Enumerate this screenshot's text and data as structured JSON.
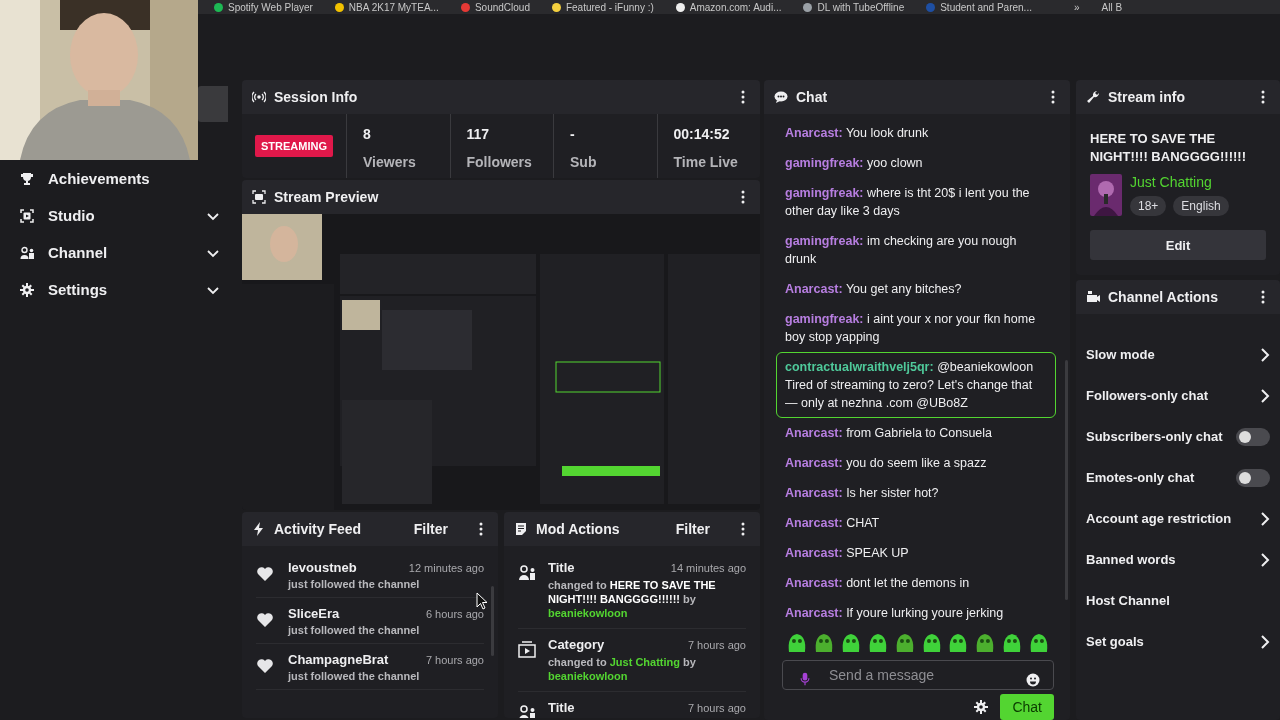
{
  "bookmarks": [
    {
      "label": "Spotify Web Player",
      "color": "#1db954"
    },
    {
      "label": "NBA 2K17 MyTEA...",
      "color": "#f2c200"
    },
    {
      "label": "SoundCloud",
      "color": "#e53935"
    },
    {
      "label": "Featured - iFunny :)",
      "color": "#f4d03f"
    },
    {
      "label": "Amazon.com: Audi...",
      "color": "#eeeeee"
    },
    {
      "label": "DL with TubeOffline",
      "color": "#9aa0a6"
    },
    {
      "label": "Student and Paren...",
      "color": "#1e4fa3"
    }
  ],
  "bookmarks_more": "»",
  "bookmarks_all": "All B",
  "sidebar": {
    "items": [
      {
        "label": "Achievements",
        "expandable": false
      },
      {
        "label": "Studio",
        "expandable": true
      },
      {
        "label": "Channel",
        "expandable": true
      },
      {
        "label": "Settings",
        "expandable": true
      }
    ]
  },
  "session_info": {
    "title": "Session Info",
    "status": "STREAMING",
    "stats": [
      {
        "value": "8",
        "label": "Viewers"
      },
      {
        "value": "117",
        "label": "Followers"
      },
      {
        "value": "-",
        "label": "Sub"
      },
      {
        "value": "00:14:52",
        "label": "Time Live"
      }
    ]
  },
  "stream_preview": {
    "title": "Stream Preview",
    "kind": "picture"
  },
  "activity_feed": {
    "title": "Activity Feed",
    "filter": "Filter",
    "items": [
      {
        "user": "levoustneb",
        "time": "12 minutes ago",
        "text": "just followed the channel"
      },
      {
        "user": "SliceEra",
        "time": "6 hours ago",
        "text": "just followed the channel"
      },
      {
        "user": "ChampagneBrat",
        "time": "7 hours ago",
        "text": "just followed the channel"
      }
    ]
  },
  "mod_actions": {
    "title": "Mod Actions",
    "filter": "Filter",
    "items": [
      {
        "kind": "title",
        "title": "Title",
        "time": "14 minutes ago",
        "prefix": "changed to",
        "value": "HERE TO SAVE THE NIGHT!!!! BANGGGG!!!!!!",
        "suffix": "by",
        "actor": "beaniekowloon"
      },
      {
        "kind": "category",
        "title": "Category",
        "time": "7 hours ago",
        "prefix": "changed to",
        "value": "Just Chatting",
        "suffix": "by",
        "actor": "beaniekowloon"
      },
      {
        "kind": "title",
        "title": "Title",
        "time": "7 hours ago"
      }
    ]
  },
  "chat": {
    "title": "Chat",
    "messages": [
      {
        "user": "Anarcast:",
        "color": "#b77ee0",
        "text": "You look drunk",
        "highlighted": false
      },
      {
        "user": "gamingfreak:",
        "color": "#b77ee0",
        "text": "yoo clown",
        "highlighted": false
      },
      {
        "user": "gamingfreak:",
        "color": "#b77ee0",
        "text": "where is tht 20$ i lent you the other day like 3 days",
        "highlighted": false
      },
      {
        "user": "gamingfreak:",
        "color": "#b77ee0",
        "text": "im checking are you nough drunk",
        "highlighted": false
      },
      {
        "user": "Anarcast:",
        "color": "#b77ee0",
        "text": "You get any bitches?",
        "highlighted": false
      },
      {
        "user": "gamingfreak:",
        "color": "#b77ee0",
        "text": "i aint your x nor your fkn home boy stop yapping",
        "highlighted": false
      },
      {
        "user": "contractualwraithvelj5qr:",
        "color": "#4fc99a",
        "text": "@beaniekowloon Tired of streaming to zero? Let's change that — only at nezhna .com @UBo8Z",
        "highlighted": true
      },
      {
        "user": "Anarcast:",
        "color": "#b77ee0",
        "text": "from Gabriela to Consuela",
        "highlighted": false
      },
      {
        "user": "Anarcast:",
        "color": "#b77ee0",
        "text": "you do seem like a spazz",
        "highlighted": false
      },
      {
        "user": "Anarcast:",
        "color": "#b77ee0",
        "text": "Is her sister hot?",
        "highlighted": false
      },
      {
        "user": "Anarcast:",
        "color": "#b77ee0",
        "text": "CHAT",
        "highlighted": false
      },
      {
        "user": "Anarcast:",
        "color": "#b77ee0",
        "text": "SPEAK UP",
        "highlighted": false
      },
      {
        "user": "Anarcast:",
        "color": "#b77ee0",
        "text": "dont let the demons in",
        "highlighted": false
      },
      {
        "user": "Anarcast:",
        "color": "#b77ee0",
        "text": "If youre lurking youre jerking",
        "highlighted": false
      }
    ],
    "placeholder": "Send a message",
    "send": "Chat"
  },
  "stream_info": {
    "title": "Stream info",
    "stream_title": "HERE TO SAVE THE NIGHT!!!! BANGGGG!!!!!!",
    "category": "Just Chatting",
    "tags": [
      "18+",
      "English"
    ],
    "edit": "Edit"
  },
  "channel_actions": {
    "title": "Channel Actions",
    "items": [
      {
        "kind": "submenu",
        "label": "Slow mode"
      },
      {
        "kind": "submenu",
        "label": "Followers-only chat"
      },
      {
        "kind": "toggle",
        "label": "Subscribers-only chat",
        "on": false
      },
      {
        "kind": "toggle",
        "label": "Emotes-only chat",
        "on": false
      },
      {
        "kind": "submenu",
        "label": "Account age restriction"
      },
      {
        "kind": "submenu",
        "label": "Banned words"
      },
      {
        "kind": "plain",
        "label": "Host Channel"
      },
      {
        "kind": "submenu",
        "label": "Set goals"
      }
    ]
  }
}
